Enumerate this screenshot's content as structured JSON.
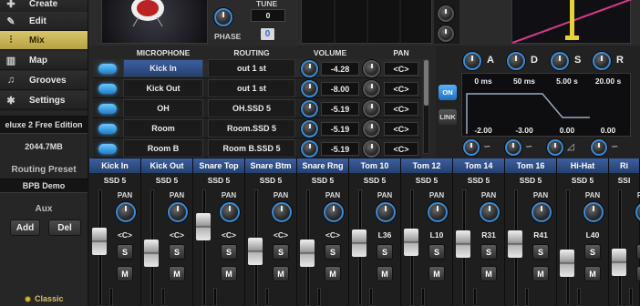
{
  "sidebar": {
    "items": [
      {
        "label": "Create",
        "icon": "create-icon"
      },
      {
        "label": "Edit",
        "icon": "edit-icon"
      },
      {
        "label": "Mix",
        "icon": "mixer-icon",
        "active": true
      },
      {
        "label": "Map",
        "icon": "keyboard-icon"
      },
      {
        "label": "Grooves",
        "icon": "music-notes-icon"
      },
      {
        "label": "Settings",
        "icon": "wrench-icon"
      }
    ],
    "kit_name": "eluxe 2 Free Edition",
    "memory": "2044.7MB",
    "routing_preset_label": "Routing Preset",
    "routing_preset_value": "BPB Demo",
    "aux_label": "Aux",
    "add_label": "Add",
    "del_label": "Del",
    "theme_label": "Classic"
  },
  "top": {
    "tune_label": "TUNE",
    "tune_value": "0",
    "phase_label": "PHASE",
    "phase_value": "0"
  },
  "mic_table": {
    "headers": {
      "mic": "MICROPHONE",
      "routing": "ROUTING",
      "volume": "VOLUME",
      "pan": "PAN"
    },
    "rows": [
      {
        "mic": "Kick In",
        "routing": "out 1 st",
        "volume": "-4.28",
        "pan": "<C>",
        "selected": true
      },
      {
        "mic": "Kick Out",
        "routing": "out 1 st",
        "volume": "-8.00",
        "pan": "<C>"
      },
      {
        "mic": "OH",
        "routing": "OH.SSD 5",
        "volume": "-5.19",
        "pan": "<C>"
      },
      {
        "mic": "Room",
        "routing": "Room.SSD 5",
        "volume": "-5.19",
        "pan": "<C>"
      },
      {
        "mic": "Room B",
        "routing": "Room B.SSD 5",
        "volume": "-5.19",
        "pan": "<C>"
      }
    ]
  },
  "envelope": {
    "labels": [
      "A",
      "D",
      "S",
      "R"
    ],
    "top_values": [
      "0 ms",
      "50 ms",
      "5.00 s",
      "20.00 s"
    ],
    "bottom_values": [
      "-2.00",
      "-3.00",
      "0.00",
      "0.00"
    ],
    "on_label": "ON",
    "link_label": "LINK"
  },
  "mixer": {
    "pan_label": "PAN",
    "solo_label": "S",
    "mute_label": "M",
    "channels": [
      {
        "name": "Kick In",
        "out": "SSD 5",
        "pan": "<C>",
        "level": 0.62
      },
      {
        "name": "Kick Out",
        "out": "SSD 5",
        "pan": "<C>",
        "level": 0.5
      },
      {
        "name": "Snare Top",
        "out": "SSD 5",
        "pan": "<C>",
        "level": 0.76
      },
      {
        "name": "Snare Btm",
        "out": "SSD 5",
        "pan": "<C>",
        "level": 0.52
      },
      {
        "name": "Snare Rng",
        "out": "SSD 5",
        "pan": "<C>",
        "level": 0.5
      },
      {
        "name": "Tom 10",
        "out": "SSD 5",
        "pan": "L36",
        "level": 0.6
      },
      {
        "name": "Tom 12",
        "out": "SSD 5",
        "pan": "L10",
        "level": 0.61
      },
      {
        "name": "Tom 14",
        "out": "SSD 5",
        "pan": "R31",
        "level": 0.59
      },
      {
        "name": "Tom 16",
        "out": "SSD 5",
        "pan": "R41",
        "level": 0.59
      },
      {
        "name": "Hi-Hat",
        "out": "SSD 5",
        "pan": "L40",
        "level": 0.4
      },
      {
        "name": "Ri",
        "out": "SSI",
        "pan": "",
        "level": 0.41
      }
    ]
  },
  "colors": {
    "accent": "#3a8ad6",
    "active_nav": "#c9b75a",
    "led": "#3aa0f0"
  }
}
